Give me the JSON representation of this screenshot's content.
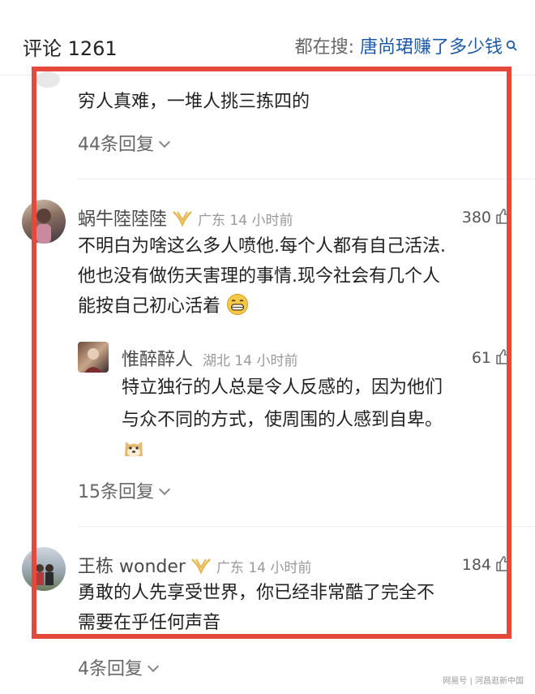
{
  "header": {
    "comment_count": "评论 1261",
    "hot_search_prefix": "都在搜: ",
    "hot_search_keyword": "唐尚珺赚了多少钱"
  },
  "thread1": {
    "text": "穷人真难，一堆人挑三拣四的",
    "replies_link": "44条回复"
  },
  "comment1": {
    "username": "蜗牛陸陸陸",
    "meta": "广东 14 小时前",
    "likes": "380",
    "lines": [
      "不明白为啥这么多人喷他.每个人都有自己活法.",
      "他也没有做伤天害理的事情.现今社会有几个人",
      "能按自己初心活着"
    ],
    "reply": {
      "username": "惟醉醉人",
      "meta": "湖北 14 小时前",
      "likes": "61",
      "lines": [
        "特立独行的人总是令人反感的，因为他们",
        "与众不同的方式，使周围的人感到自卑。"
      ]
    },
    "replies_link": "15条回复"
  },
  "comment2": {
    "username": "王栋 wonder",
    "meta": "广东 14 小时前",
    "likes": "184",
    "lines": [
      "勇敢的人先享受世界，你已经非常酷了完全不",
      "需要在乎任何声音"
    ],
    "replies_link": "4条回复"
  },
  "watermark": "网易号 | 河昌逛新中国",
  "colors": {
    "highlight_border": "#e5493c",
    "keyword_blue": "#1e5aa8",
    "vip_badge": "#e8b64c"
  },
  "icons": [
    "search-icon",
    "vip-badge-icon",
    "thumb-up-icon",
    "chevron-down-icon",
    "grin-emoji",
    "doge-emoji"
  ]
}
